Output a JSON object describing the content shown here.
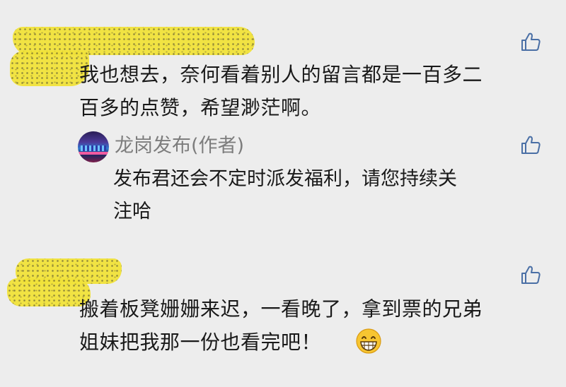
{
  "comments": [
    {
      "text_line1": "我也想去，奈何看着别人的留言都是一百多二",
      "text_line2": "百多的点赞，希望渺茫啊。",
      "reply": {
        "author": "龙岗发布(作者)",
        "text_line1": "发布君还会不定时派发福利，请您持续关",
        "text_line2": "注哈"
      }
    },
    {
      "text_line1": "搬着板凳姗姗来迟，一看晚了，拿到票的兄弟",
      "text_line2": "姐妹把我那一份也看完吧！",
      "emoji": "grinning-face-emoji"
    }
  ],
  "icons": {
    "like": "thumbs-up-outline",
    "color": "#4a6fa5"
  }
}
